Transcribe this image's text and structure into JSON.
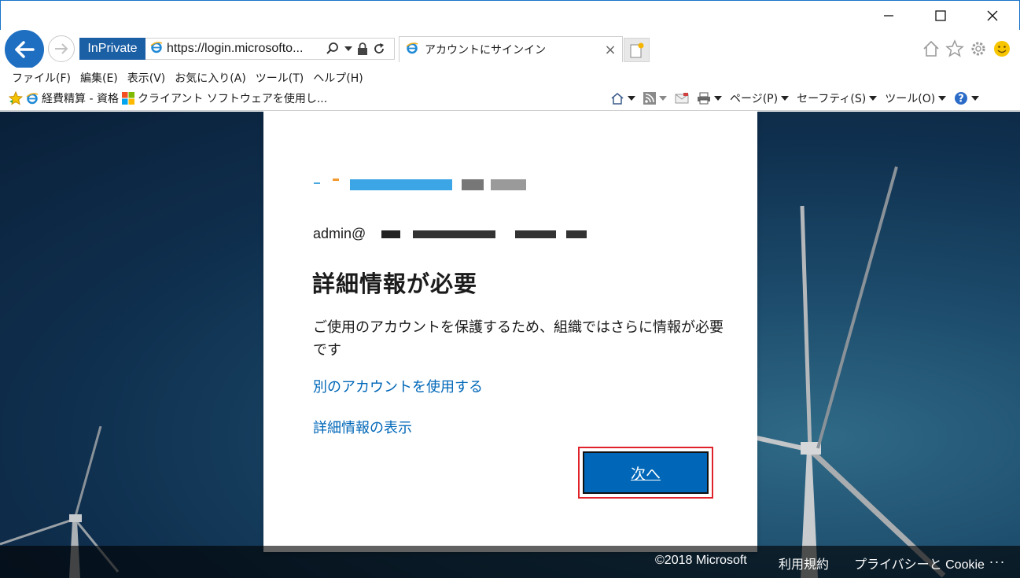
{
  "window": {
    "minimize_icon": "minimize-icon",
    "maximize_icon": "maximize-icon",
    "close_icon": "close-icon"
  },
  "nav": {
    "inprivate_label": "InPrivate",
    "url": "https://login.microsofto...",
    "tab_title": "アカウントにサインイン",
    "tab_close": "×"
  },
  "menu": {
    "items": [
      "ファイル(F)",
      "編集(E)",
      "表示(V)",
      "お気に入り(A)",
      "ツール(T)",
      "ヘルプ(H)"
    ]
  },
  "favorites": {
    "items": [
      "経費精算 - 資格",
      "クライアント ソフトウェアを使用し..."
    ]
  },
  "commandbar": {
    "page": "ページ(P)",
    "safety": "セーフティ(S)",
    "tools": "ツール(O)"
  },
  "signin": {
    "identity_prefix": "admin@",
    "title": "詳細情報が必要",
    "description": "ご使用のアカウントを保護するため、組織ではさらに情報が必要です",
    "link_other_account": "別のアカウントを使用する",
    "link_more_info": "詳細情報の表示",
    "next_button": "次へ"
  },
  "footer": {
    "copyright": "©2018 Microsoft",
    "terms": "利用規約",
    "privacy": "プライバシーと Cookie",
    "more": "..."
  },
  "colors": {
    "accent": "#0067b8",
    "highlight": "#e0232a",
    "inprivate": "#1b5fa5"
  }
}
